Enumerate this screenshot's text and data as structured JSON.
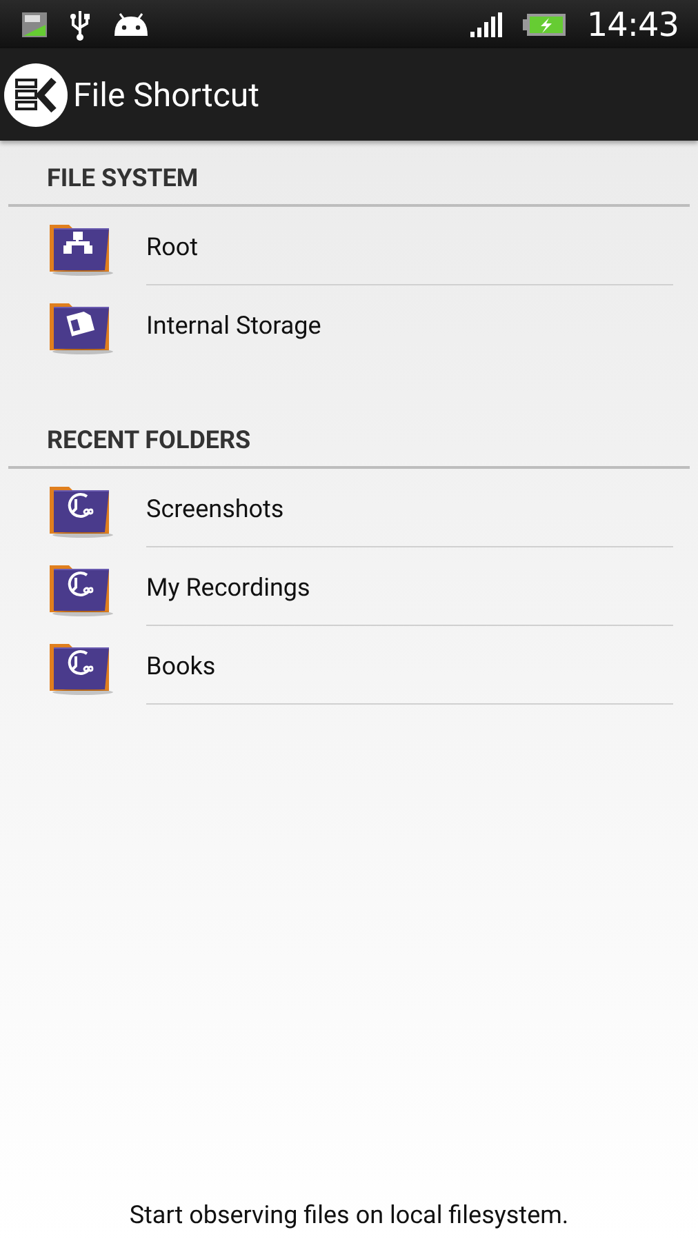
{
  "status_bar": {
    "time": "14:43"
  },
  "app_bar": {
    "title": "File Shortcut"
  },
  "sections": [
    {
      "title": "FILE SYSTEM",
      "items": [
        {
          "label": "Root",
          "kind": "network",
          "divider": true
        },
        {
          "label": "Internal Storage",
          "kind": "storage",
          "divider": false
        }
      ]
    },
    {
      "title": "RECENT FOLDERS",
      "items": [
        {
          "label": "Screenshots",
          "kind": "recent",
          "divider": true
        },
        {
          "label": "My Recordings",
          "kind": "recent",
          "divider": true
        },
        {
          "label": "Books",
          "kind": "recent",
          "divider": true
        }
      ]
    }
  ],
  "footer": "Start observing files on local filesystem."
}
